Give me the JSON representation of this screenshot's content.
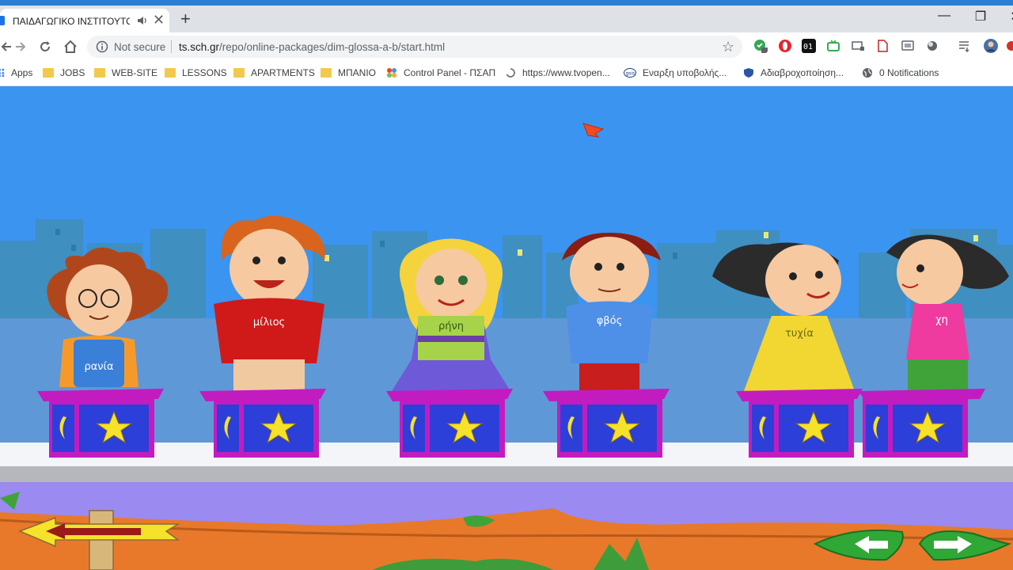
{
  "browser": {
    "tab": {
      "title": "ΠΑΙΔΑΓΩΓΙΚΟ ΙΝΣΤΙΤΟΥΤΟ -",
      "close_glyph": "✕"
    },
    "new_tab_glyph": "+",
    "window_controls": {
      "minimize": "—",
      "restore": "❐",
      "close": "✕"
    },
    "address_bar": {
      "security_label": "Not secure",
      "host": "ts.sch.gr",
      "path": "/repo/online-packages/dim-glossa-a-b/start.html"
    },
    "extensions": [
      "shield-extension-icon",
      "opera-icon",
      "01-extension-icon",
      "tv-extension-icon",
      "cast-icon",
      "pdf-icon",
      "screen-capture-icon",
      "circle-extension-icon",
      "reading-list-icon",
      "profile-avatar"
    ],
    "bookmarks": [
      {
        "label": "Apps",
        "icon": "apps-grid-icon"
      },
      {
        "label": "JOBS",
        "icon": "folder-icon"
      },
      {
        "label": "WEB-SITE",
        "icon": "folder-icon"
      },
      {
        "label": "LESSONS",
        "icon": "folder-icon"
      },
      {
        "label": "APARTMENTS",
        "icon": "folder-icon"
      },
      {
        "label": "ΜΠΑΝΙΟ",
        "icon": "folder-icon"
      },
      {
        "label": "Control Panel - ΠΣΑΠ",
        "icon": "joomla-icon"
      },
      {
        "label": "https://www.tvopen...",
        "icon": "loading-icon"
      },
      {
        "label": "Εναρξη υποβολής...",
        "icon": "gsis-icon"
      },
      {
        "label": "Αδιαβροχοποίηση...",
        "icon": "shield-site-icon"
      },
      {
        "label": "0 Notifications",
        "icon": "globe-icon"
      }
    ]
  },
  "game": {
    "kids": [
      {
        "shirt_text": "ρανία",
        "shirt_color": "#3a7fd8",
        "hair_color": "#b0471c"
      },
      {
        "shirt_text": "μίλιος",
        "shirt_color": "#d01a1a",
        "hair_color": "#d8641e"
      },
      {
        "shirt_text": "ρήνη",
        "shirt_color": "#a7d34a",
        "hair_color": "#f5d33c"
      },
      {
        "shirt_text": "φβός",
        "shirt_color": "#4e8fe8",
        "hair_color": "#8b1d12"
      },
      {
        "shirt_text": "τυχία",
        "shirt_color": "#f2d733",
        "hair_color": "#2b2b2b"
      },
      {
        "shirt_text": "χη",
        "shirt_color": "#ef3a9f",
        "hair_color": "#2b2b2b"
      }
    ],
    "colors": {
      "sky": "#3b94f0",
      "buildings": "#3f8fc0",
      "stage_floor": "#5f98d6",
      "box_magenta": "#c21cc1",
      "box_blue": "#2c3fd8",
      "star": "#f6e12b",
      "branch": "#e8792a",
      "lavender": "#9b8af0"
    }
  }
}
